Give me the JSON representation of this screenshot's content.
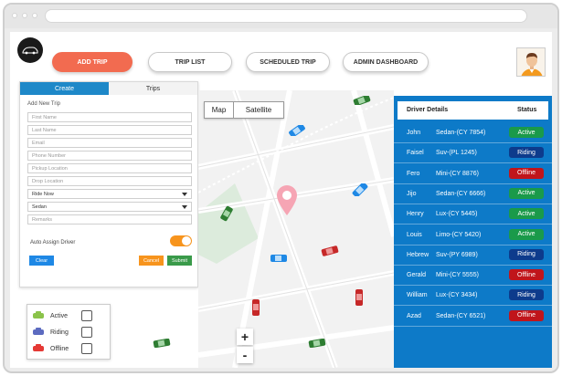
{
  "nav": {
    "add_trip": "ADD TRIP",
    "trip_list": "TRIP LIST",
    "scheduled_trip": "SCHEDULED TRIP",
    "admin_dashboard": "ADMIN DASHBOARD"
  },
  "form": {
    "tabs": [
      "Create",
      "Trips"
    ],
    "title": "Add New Trip",
    "first_name_placeholder": "First Name",
    "last_name_placeholder": "Last Name",
    "email_placeholder": "Email",
    "phone_placeholder": "Phone Number",
    "pickup_placeholder": "Pickup Location",
    "drop_placeholder": "Drop Location",
    "ride_type": "Ride Now",
    "car_type": "Sedan",
    "remarks_placeholder": "Remarks",
    "auto_assign_label": "Auto Assign Driver",
    "auto_assign_on": true,
    "clear": "Clear",
    "cancel": "Cancel",
    "submit": "Submit"
  },
  "map": {
    "map_label": "Map",
    "satellite_label": "Satellite",
    "zoom_in": "+",
    "zoom_out": "-"
  },
  "legend": {
    "items": [
      {
        "label": "Active",
        "color": "#8bc34a"
      },
      {
        "label": "Riding",
        "color": "#3f51b5"
      },
      {
        "label": "Offline",
        "color": "#e53935"
      }
    ]
  },
  "drivers": {
    "header_name": "Driver Details",
    "header_status": "Status",
    "rows": [
      {
        "name": "John",
        "car": "Sedan-(CY 7854)",
        "status": "Active"
      },
      {
        "name": "Faisel",
        "car": "Suv-(PL 1245)",
        "status": "Riding"
      },
      {
        "name": "Fero",
        "car": "Mini-(CY 8876)",
        "status": "Offline"
      },
      {
        "name": "Jijo",
        "car": "Sedan-(CY 6666)",
        "status": "Active"
      },
      {
        "name": "Henry",
        "car": "Lux-(CY 5445)",
        "status": "Active"
      },
      {
        "name": "Louis",
        "car": "Limo-(CY 5420)",
        "status": "Active"
      },
      {
        "name": "Hebrew",
        "car": "Suv-(PY 6989)",
        "status": "Riding"
      },
      {
        "name": "Gerald",
        "car": "Mini-(CY 5555)",
        "status": "Offline"
      },
      {
        "name": "William",
        "car": "Lux-(CY 3434)",
        "status": "Riding"
      },
      {
        "name": "Azad",
        "car": "Sedan-(CY 6521)",
        "status": "Offline"
      }
    ]
  },
  "colors": {
    "accent": "#f26b50",
    "primary_blue": "#0d7ac8",
    "active": "#1a9a4a",
    "riding": "#0d3b8c",
    "offline": "#c0151b"
  }
}
